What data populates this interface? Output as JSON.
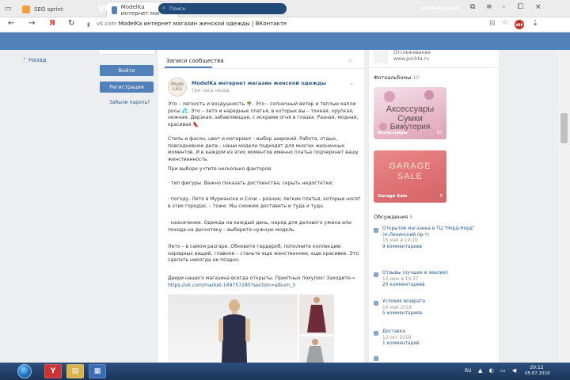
{
  "browser": {
    "tabs": [
      {
        "label": "SEO sprint"
      },
      {
        "label": "ModelKa интернет маг",
        "close": "×"
      }
    ],
    "new_tab": "+",
    "window_controls": [
      "⧉",
      "≡",
      "–",
      "⧠",
      "×"
    ],
    "nav": {
      "back": "←",
      "forward": "→",
      "yandex": "Я",
      "reload": "↻"
    },
    "url_domain": "vk.com",
    "url_title": "ModelKa интернет магазин женской одежды | ВКонтакте",
    "right_icons": [
      "⊟",
      "☆"
    ],
    "adblock_badge": "ABP",
    "download": "⇣"
  },
  "vk": {
    "logo": "VK",
    "search_placeholder": "Поиск",
    "register_top": "регистрация",
    "back_link": "Назад",
    "login_button": "Войти",
    "register_button": "Регистрация",
    "forgot": "Забыли пароль?"
  },
  "post": {
    "tab": "Записи сообщества",
    "avatar_text": "Mode Lika",
    "author": "ModelKa интернет магазин женской одежды",
    "time": "три часа назад",
    "paragraphs": [
      "Это – легкость и воздушность 🌴. Это – солнечный ветер и теплые капли росы 💦. Это – лето и нарядные платья, в которых вы – тонкая, хрупкая, нежная. Дерзкая, забавляющая, с искрами огня в глазах. Разная, модная, красивая 👠",
      "Стиль и фасон, цвет и материал – выбор широкий. Работа, отдых, повседневное дела – наши модели подходят для многих жизненных моментов. И в каждом из этих моментов именно платье подчеркнет вашу женственность.",
      "При выборе учтите несколько факторов:",
      "· тип фигуры. Важно показать достоинства, скрыть недостатки;",
      "· погоду. Лето в Мурманске и Сочи – разное; легкие платья, которые носят в этих городах, – тоже. Мы сможем доставить и туда и туда.",
      "· назначение. Одежда на каждый день, наряд для делового ужина или похода на дискотеку – выберите нужную модель.",
      "Лето – в самом разгаре. Обновите гардероб, пополните коллекцию нарядных вещей, главное – станьте еще женственнее, еще красивее. Это сделать никогда не поздно.",
      "Двери нашего магазина всегда открыты. Приятных покупок! Заходите-»"
    ],
    "link": "https://vk.com/market-169757285?section=album_3"
  },
  "right": {
    "top_lines": [
      "Отслеживание",
      "www.pochta.ru"
    ],
    "albums_title": "Фотоальбомы",
    "albums_count": "10",
    "album1": {
      "title": "Аксессуары",
      "title2": "Сумки",
      "title3": "Бижутерия",
      "caption": "Аксессуары",
      "count": "62"
    },
    "album2": {
      "title": "GARAGE",
      "title2": "SALE",
      "caption": "Garage Sale",
      "count": "5"
    },
    "discussions_title": "Обсуждения",
    "discussions_count": "5",
    "discussions": [
      {
        "title": "Открытие магазина в ТЦ \"Норд-Норд\" (м.Ленинский пр-т)",
        "date": "15 мая в 19:28",
        "comments": "9 комментариев"
      },
      {
        "title": "Отзывы (лучшие и хвалим)",
        "date": "12 июн в 10:37",
        "comments": "20 комментариев"
      },
      {
        "title": "Условия возврата",
        "date": "10 мая 2018",
        "comments": "5 комментариев"
      },
      {
        "title": "Доставка",
        "date": "12 окт 2018",
        "comments": "1 комментарий"
      },
      {
        "title": "",
        "date": "",
        "comments": ""
      }
    ]
  },
  "taskbar": {
    "lang": "RU",
    "tray": "▲ ◐ ▭ ◀",
    "time": "20:12",
    "date": "05.07.2019"
  }
}
